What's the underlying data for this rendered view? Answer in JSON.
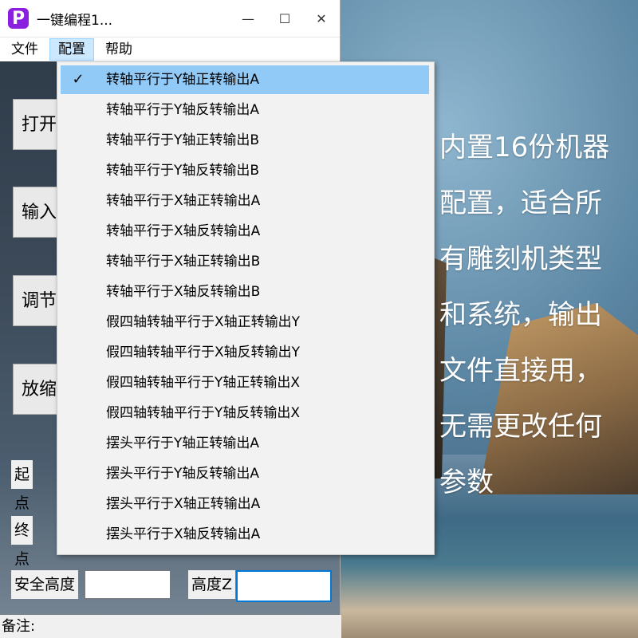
{
  "window": {
    "title": "一键编程1...",
    "logo_letter": "P",
    "controls": {
      "minimize": "—",
      "maximize": "☐",
      "close": "✕"
    }
  },
  "menubar": {
    "items": [
      {
        "label": "文件"
      },
      {
        "label": "配置",
        "active": true
      },
      {
        "label": "帮助"
      }
    ]
  },
  "buttons": [
    {
      "label": "打开"
    },
    {
      "label": "输入"
    },
    {
      "label": "调节"
    },
    {
      "label": "放缩"
    }
  ],
  "form": {
    "start_label": "起点",
    "end_label": "终点",
    "safe_height_label": "安全高度",
    "height_z_label": "高度Z",
    "safe_height_value": "",
    "height_z_value": ""
  },
  "status": {
    "notes_label": "备注:"
  },
  "config_menu": {
    "checkmark": "✓",
    "items": [
      {
        "label": "转轴平行于Y轴正转输出A",
        "checked": true
      },
      {
        "label": "转轴平行于Y轴反转输出A"
      },
      {
        "label": "转轴平行于Y轴正转输出B"
      },
      {
        "label": "转轴平行于Y轴反转输出B"
      },
      {
        "label": "转轴平行于X轴正转输出A"
      },
      {
        "label": "转轴平行于X轴反转输出A"
      },
      {
        "label": "转轴平行于X轴正转输出B"
      },
      {
        "label": "转轴平行于X轴反转输出B"
      },
      {
        "label": "假四轴转轴平行于X轴正转输出Y"
      },
      {
        "label": "假四轴转轴平行于X轴反转输出Y"
      },
      {
        "label": "假四轴转轴平行于Y轴正转输出X"
      },
      {
        "label": "假四轴转轴平行于Y轴反转输出X"
      },
      {
        "label": "摆头平行于Y轴正转输出A"
      },
      {
        "label": "摆头平行于Y轴反转输出A"
      },
      {
        "label": "摆头平行于X轴正转输出A"
      },
      {
        "label": "摆头平行于X轴反转输出A"
      }
    ]
  },
  "promo_text": {
    "lines": [
      "内置16份机器",
      "配置，适合所",
      "有雕刻机类型",
      "和系统，输出",
      "文件直接用，",
      "无需更改任何",
      "参数"
    ]
  },
  "colors": {
    "highlight": "#91c9f7",
    "logo": "#8a1fe0",
    "focus_border": "#0078d7"
  }
}
